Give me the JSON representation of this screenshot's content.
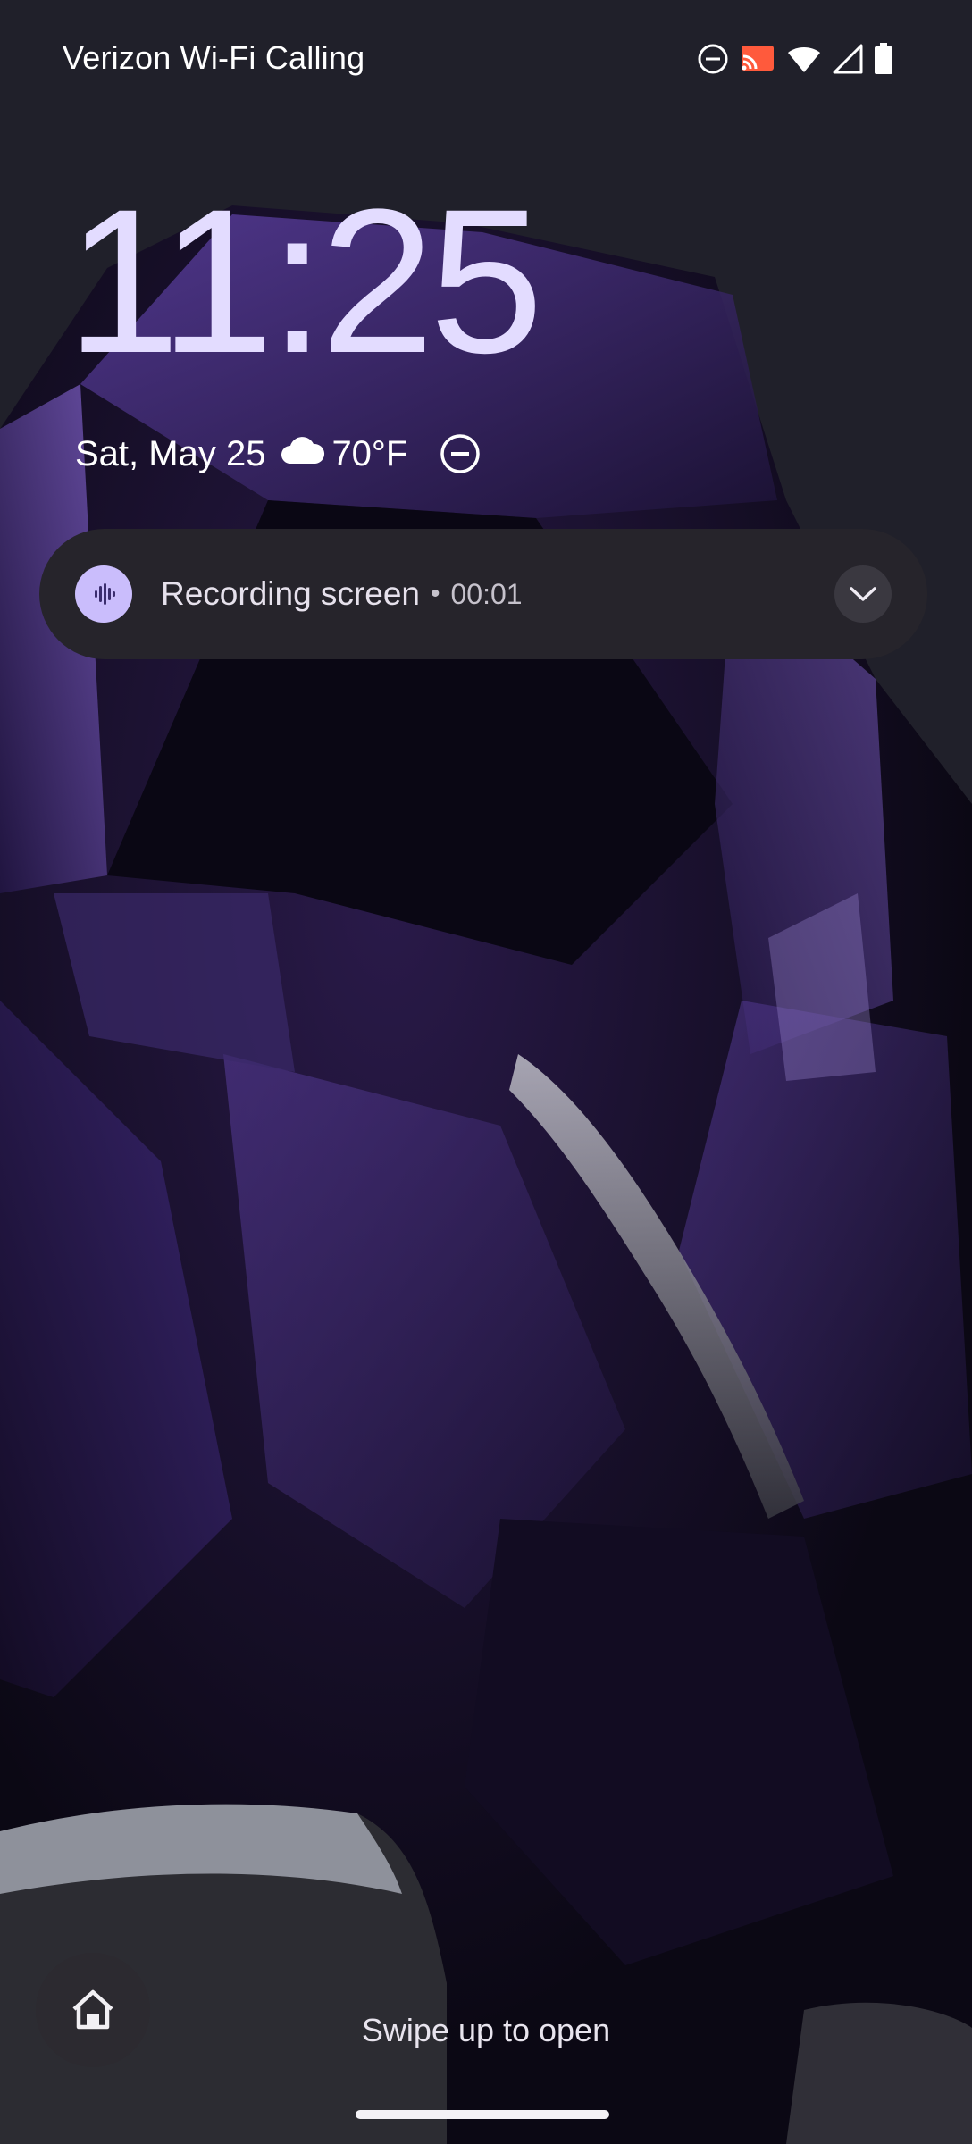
{
  "status_bar": {
    "carrier": "Verizon Wi-Fi Calling",
    "icons": [
      "do-not-disturb-icon",
      "cast-icon",
      "wifi-icon",
      "signal-icon",
      "battery-icon"
    ]
  },
  "lock_screen": {
    "time": "11:25",
    "date": "Sat, May 25",
    "weather_icon": "cloud-icon",
    "temperature": "70°F",
    "dnd_icon": "do-not-disturb-icon"
  },
  "notification": {
    "icon": "sound-wave-icon",
    "title": "Recording screen",
    "separator": "•",
    "elapsed": "00:01",
    "expand_icon": "chevron-down-icon"
  },
  "bottom": {
    "shortcut_icon": "home-icon",
    "swipe_hint": "Swipe up to open"
  },
  "colors": {
    "clock": "#e3dcff",
    "notification_bg": "#26242b",
    "notification_icon_bg": "#cabdfc",
    "wallpaper_accent": "#4a2f8a"
  }
}
